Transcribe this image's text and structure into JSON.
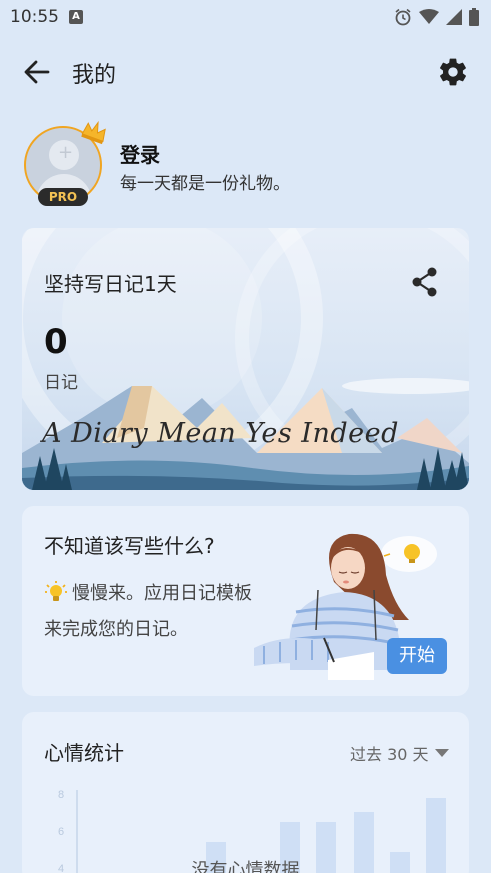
{
  "status_bar": {
    "time": "10:55",
    "icons": [
      "notification-a-icon",
      "alarm-icon",
      "wifi-icon",
      "signal-icon",
      "battery-icon"
    ]
  },
  "app_bar": {
    "title": "我的",
    "back_icon": "arrow-left-icon",
    "settings_icon": "gear-icon"
  },
  "profile": {
    "login_label": "登录",
    "tagline": "每一天都是一份礼物。",
    "badge": "PRO"
  },
  "diary_card": {
    "streak_text": "坚持写日记1天",
    "count": "0",
    "count_label": "日记",
    "slogan": "A Diary Mean Yes Indeed",
    "share_icon": "share-icon"
  },
  "prompt_card": {
    "title": "不知道该写些什么?",
    "body": "慢慢来。应用日记模板来完成您的日记。",
    "start_label": "开始"
  },
  "mood_card": {
    "title": "心情统计",
    "range": "过去 30 天",
    "empty_message": "没有心情数据",
    "axis_ticks": [
      "8",
      "6",
      "4"
    ],
    "bar_values": [
      2,
      3,
      3,
      3.5,
      1.5,
      4.2
    ]
  },
  "colors": {
    "background": "#dce8f7",
    "accent": "#4a90e2",
    "avatar_ring": "#f0a522",
    "pro_text": "#f3c254"
  }
}
